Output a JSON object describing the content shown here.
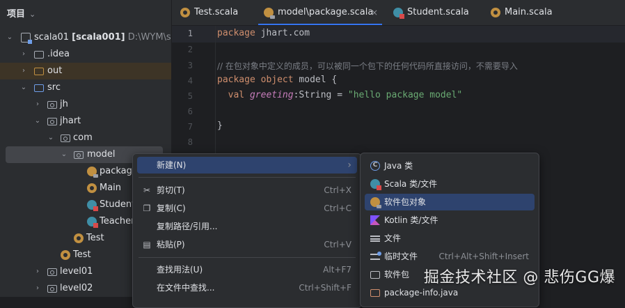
{
  "project": {
    "header": "项目",
    "tree": [
      {
        "label": "scala01",
        "suffix": "[scala001]",
        "path": "D:\\WYM\\scala",
        "icon": "module-icon"
      },
      {
        "label": ".idea",
        "icon": "folder-icon"
      },
      {
        "label": "out",
        "icon": "folder-icon"
      },
      {
        "label": "src",
        "icon": "source-folder-icon"
      },
      {
        "label": "jh",
        "icon": "package-icon"
      },
      {
        "label": "jhart",
        "icon": "package-icon"
      },
      {
        "label": "com",
        "icon": "package-icon"
      },
      {
        "label": "model",
        "icon": "package-icon"
      },
      {
        "label": "package",
        "icon": "package-object-icon"
      },
      {
        "label": "Main",
        "icon": "scala-object-icon"
      },
      {
        "label": "Student",
        "icon": "scala-class-icon"
      },
      {
        "label": "Teacher",
        "icon": "scala-class-icon"
      },
      {
        "label": "Test",
        "icon": "scala-object-icon"
      },
      {
        "label": "Test",
        "icon": "scala-object-icon"
      },
      {
        "label": "level01",
        "icon": "package-icon"
      },
      {
        "label": "level02",
        "icon": "package-icon"
      }
    ]
  },
  "tabs": [
    {
      "label": "Test.scala",
      "icon": "scala-object-icon"
    },
    {
      "label": "model\\package.scala",
      "icon": "package-object-icon",
      "active": true
    },
    {
      "label": "Student.scala",
      "icon": "scala-class-icon"
    },
    {
      "label": "Main.scala",
      "icon": "scala-object-icon"
    }
  ],
  "editor": {
    "line_numbers": [
      "1",
      "2",
      "3",
      "4",
      "5",
      "6",
      "7",
      "8"
    ],
    "code": {
      "l1_kw": "package",
      "l1_rest": " jhart.com",
      "l3_comment": "// 在包对象中定义的成员，可以被同一个包下的任何代码所直接访问，不需要导入",
      "l4_kw1": "package",
      "l4_kw2": " object",
      "l4_rest": " model {",
      "l5_kw": "  val ",
      "l5_name": "greeting",
      "l5_type": ":String = ",
      "l5_str": "\"hello package model\"",
      "l7_brace": "}"
    }
  },
  "context_menu": {
    "items": [
      {
        "label": "新建(N)",
        "shortcut": "",
        "submenu": true
      },
      {
        "label": "剪切(T)",
        "shortcut": "Ctrl+X",
        "icon": "scissors-icon"
      },
      {
        "label": "复制(C)",
        "shortcut": "Ctrl+C",
        "icon": "copy-icon"
      },
      {
        "label": "复制路径/引用...",
        "shortcut": ""
      },
      {
        "label": "粘贴(P)",
        "shortcut": "Ctrl+V",
        "icon": "paste-icon"
      },
      {
        "label": "查找用法(U)",
        "shortcut": "Alt+F7"
      },
      {
        "label": "在文件中查找...",
        "shortcut": "Ctrl+Shift+F"
      }
    ],
    "submenu_arrow": "›"
  },
  "new_submenu": {
    "items": [
      {
        "label": "Java 类",
        "icon": "java-class-icon"
      },
      {
        "label": "Scala 类/文件",
        "icon": "scala-class-icon"
      },
      {
        "label": "软件包对象",
        "icon": "package-object-icon",
        "active": true
      },
      {
        "label": "Kotlin 类/文件",
        "icon": "kotlin-icon"
      },
      {
        "label": "文件",
        "icon": "file-icon"
      },
      {
        "label": "临时文件",
        "shortcut": "Ctrl+Alt+Shift+Insert",
        "icon": "scratch-file-icon"
      },
      {
        "label": "软件包",
        "icon": "package-icon"
      },
      {
        "label": "package-info.java",
        "icon": "package-info-icon"
      }
    ]
  },
  "watermark": "掘金技术社区 @ 悲伤GG爆"
}
